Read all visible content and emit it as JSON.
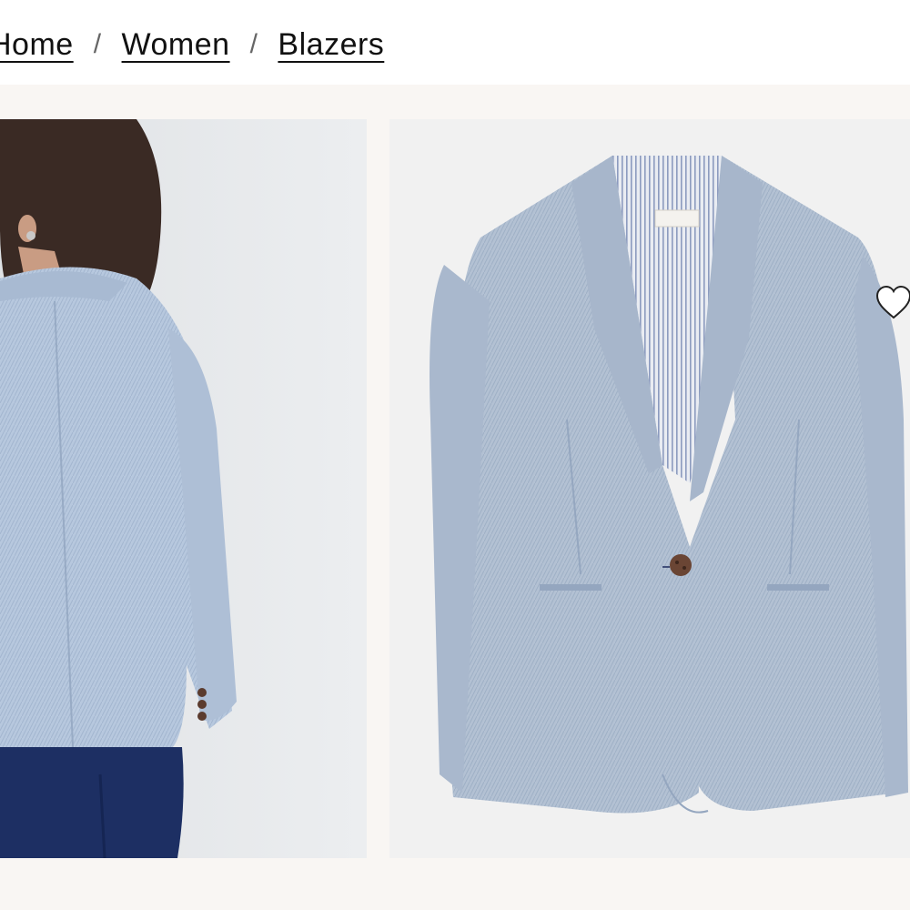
{
  "breadcrumb": {
    "items": [
      "Home",
      "Women",
      "Blazers"
    ],
    "separator": "/"
  },
  "gallery": {
    "images": [
      {
        "name": "product-image-back-view",
        "subject": "model wearing blazer, back view"
      },
      {
        "name": "product-image-front-flat",
        "subject": "blazer front flat view"
      }
    ]
  },
  "wishlist": {
    "icon": "heart-icon"
  },
  "colors": {
    "fabric": "#b3c3d8",
    "fabric_dark": "#8d9fb7",
    "pants": "#1d2f63",
    "gallery_bg": "#f9f6f3"
  }
}
